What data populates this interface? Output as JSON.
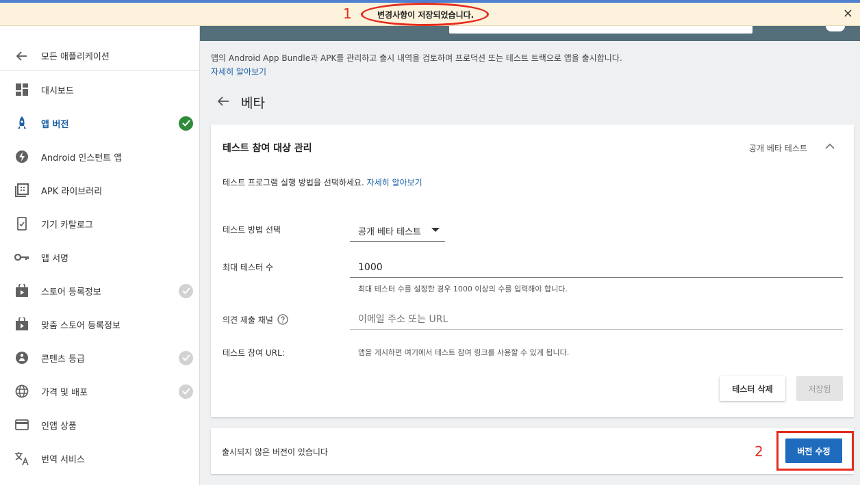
{
  "notification": {
    "message": "변경사항이 저장되었습니다.",
    "close_icon": "×"
  },
  "annotations": {
    "marker_1": "1",
    "marker_2": "2",
    "color": "#e42b1c"
  },
  "sidebar": {
    "back_label": "모든 애플리케이션",
    "items": [
      {
        "label": "대시보드",
        "icon": "dashboard-icon",
        "status": "none"
      },
      {
        "label": "앱 버전",
        "icon": "rocket-icon",
        "status": "complete"
      },
      {
        "label": "Android 인스턴트 앱",
        "icon": "bolt-icon",
        "status": "none"
      },
      {
        "label": "APK 라이브러리",
        "icon": "library-icon",
        "status": "none"
      },
      {
        "label": "기기 카탈로그",
        "icon": "device-icon",
        "status": "none"
      },
      {
        "label": "앱 서명",
        "icon": "key-icon",
        "status": "none"
      },
      {
        "label": "스토어 등록정보",
        "icon": "store-icon",
        "status": "pending"
      },
      {
        "label": "맞춤 스토어 등록정보",
        "icon": "store-icon",
        "status": "none"
      },
      {
        "label": "콘텐츠 등급",
        "icon": "rating-icon",
        "status": "pending"
      },
      {
        "label": "가격 및 배포",
        "icon": "globe-icon",
        "status": "pending"
      },
      {
        "label": "인앱 상품",
        "icon": "card-icon",
        "status": "none"
      },
      {
        "label": "번역 서비스",
        "icon": "translate-icon",
        "status": "none"
      }
    ]
  },
  "main": {
    "intro": "앱의 Android App Bundle과 APK를 관리하고 출시 내역을 검토하며 프로덕션 또는 테스트 트랙으로 앱을 출시합니다.",
    "intro_link": "자세히 알아보기",
    "page_title": "베타"
  },
  "tester_card": {
    "title": "테스트 참여 대상 관리",
    "badge": "공개 베타 테스트",
    "subtitle": "테스트 프로그램 실행 방법을 선택하세요.",
    "subtitle_link": "자세히 알아보기",
    "method_label": "테스트 방법 선택",
    "method_value": "공개 베타 테스트",
    "max_testers_label": "최대 테스터 수",
    "max_testers_value": "1000",
    "max_testers_hint": "최대 테스터 수를 설정한 경우 1000 이상의 수를 입력해야 합니다.",
    "feedback_label": "의견 제출 채널",
    "feedback_placeholder": "이메일 주소 또는 URL",
    "url_label": "테스트 참여 URL:",
    "url_hint": "앱을 게시하면 여기에서 테스트 참여 링크를 사용할 수 있게 됩니다.",
    "delete_button": "테스터 삭제",
    "saved_button": "저장됨"
  },
  "footer": {
    "text": "출시되지 않은 버전이 있습니다",
    "edit_button": "버전 수정"
  },
  "colors": {
    "accent": "#1f6cbf",
    "link": "#1a5fa8",
    "success": "#2e8b3a",
    "header": "#546e7a"
  }
}
